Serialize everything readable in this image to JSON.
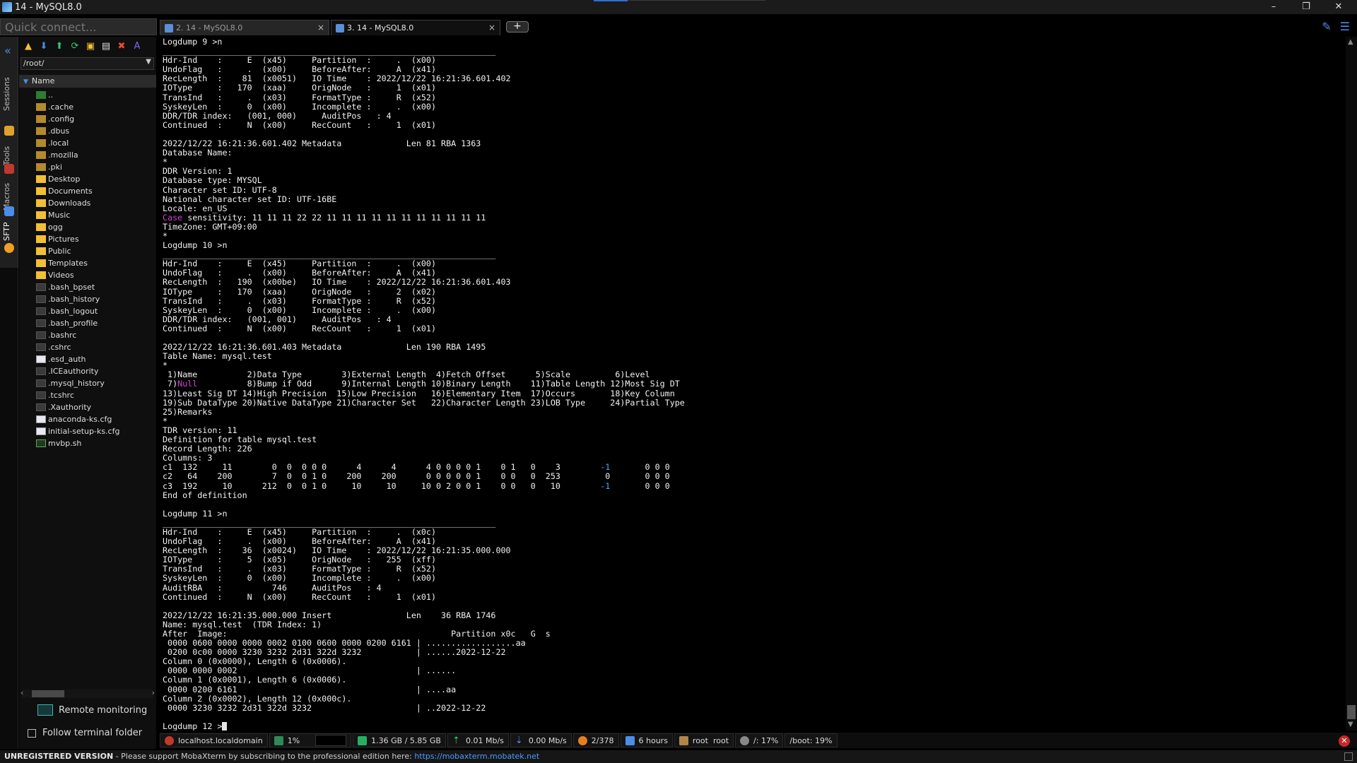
{
  "window": {
    "title": "14 - MySQL8.0",
    "minimize": "–",
    "maximize": "❐",
    "close": "✕"
  },
  "quick_connect": {
    "placeholder": "Quick connect..."
  },
  "tabs": [
    {
      "label": "2. 14 - MySQL8.0",
      "close": "×"
    },
    {
      "label": "3. 14 - MySQL8.0",
      "close": "×"
    }
  ],
  "new_tab": "+",
  "side_tabs": {
    "sessions": "Sessions",
    "tools": "Tools",
    "macros": "Macros",
    "sftp": "SFTP"
  },
  "sftp": {
    "path": "/root/",
    "column": "Name",
    "items": [
      {
        "name": "..",
        "kind": "up"
      },
      {
        "name": ".cache",
        "kind": "folder-hidden"
      },
      {
        "name": ".config",
        "kind": "folder-hidden"
      },
      {
        "name": ".dbus",
        "kind": "folder-hidden"
      },
      {
        "name": ".local",
        "kind": "folder-hidden"
      },
      {
        "name": ".mozilla",
        "kind": "folder-hidden"
      },
      {
        "name": ".pki",
        "kind": "folder-hidden"
      },
      {
        "name": "Desktop",
        "kind": "folder"
      },
      {
        "name": "Documents",
        "kind": "folder"
      },
      {
        "name": "Downloads",
        "kind": "folder"
      },
      {
        "name": "Music",
        "kind": "folder"
      },
      {
        "name": "ogg",
        "kind": "folder"
      },
      {
        "name": "Pictures",
        "kind": "folder"
      },
      {
        "name": "Public",
        "kind": "folder"
      },
      {
        "name": "Templates",
        "kind": "folder"
      },
      {
        "name": "Videos",
        "kind": "folder"
      },
      {
        "name": ".bash_bpset",
        "kind": "file"
      },
      {
        "name": ".bash_history",
        "kind": "file"
      },
      {
        "name": ".bash_logout",
        "kind": "file"
      },
      {
        "name": ".bash_profile",
        "kind": "file"
      },
      {
        "name": ".bashrc",
        "kind": "file"
      },
      {
        "name": ".cshrc",
        "kind": "file"
      },
      {
        "name": ".esd_auth",
        "kind": "cfg"
      },
      {
        "name": ".ICEauthority",
        "kind": "file"
      },
      {
        "name": ".mysql_history",
        "kind": "file"
      },
      {
        "name": ".tcshrc",
        "kind": "file"
      },
      {
        "name": ".Xauthority",
        "kind": "file"
      },
      {
        "name": "anaconda-ks.cfg",
        "kind": "cfg"
      },
      {
        "name": "initial-setup-ks.cfg",
        "kind": "cfg"
      },
      {
        "name": "mvbp.sh",
        "kind": "sh"
      }
    ],
    "remote_monitoring": "Remote monitoring",
    "follow_terminal_folder": "Follow terminal folder"
  },
  "terminal": {
    "lines": [
      "Logdump 9 >n",
      "___________________________________________________________________",
      "Hdr-Ind    :     E  (x45)     Partition  :     .  (x00)",
      "UndoFlag   :     .  (x00)     BeforeAfter:     A  (x41)",
      "RecLength  :    81  (x0051)   IO Time    : 2022/12/22 16:21:36.601.402",
      "IOType     :   170  (xaa)     OrigNode   :     1  (x01)",
      "TransInd   :     .  (x03)     FormatType :     R  (x52)",
      "SyskeyLen  :     0  (x00)     Incomplete :     .  (x00)",
      "DDR/TDR index:   (001, 000)     AuditPos   : 4",
      "Continued  :     N  (x00)     RecCount   :     1  (x01)",
      "",
      "2022/12/22 16:21:36.601.402 Metadata             Len 81 RBA 1363",
      "Database Name:",
      "*",
      "DDR Version: 1",
      "Database type: MYSQL",
      "Character set ID: UTF-8",
      "National character set ID: UTF-16BE",
      "Locale: en_US",
      "Case sensitivity: 11 11 11 22 22 11 11 11 11 11 11 11 11 11 11 11",
      "TimeZone: GMT+09:00",
      "*",
      "Logdump 10 >n",
      "___________________________________________________________________",
      "Hdr-Ind    :     E  (x45)     Partition  :     .  (x00)",
      "UndoFlag   :     .  (x00)     BeforeAfter:     A  (x41)",
      "RecLength  :   190  (x00be)   IO Time    : 2022/12/22 16:21:36.601.403",
      "IOType     :   170  (xaa)     OrigNode   :     2  (x02)",
      "TransInd   :     .  (x03)     FormatType :     R  (x52)",
      "SyskeyLen  :     0  (x00)     Incomplete :     .  (x00)",
      "DDR/TDR index:   (001, 001)     AuditPos   : 4",
      "Continued  :     N  (x00)     RecCount   :     1  (x01)",
      "",
      "2022/12/22 16:21:36.601.403 Metadata             Len 190 RBA 1495",
      "Table Name: mysql.test",
      "*",
      " 1)Name          2)Data Type        3)External Length  4)Fetch Offset      5)Scale         6)Level",
      " 7)Null          8)Bump if Odd      9)Internal Length 10)Binary Length    11)Table Length 12)Most Sig DT",
      "13)Least Sig DT 14)High Precision  15)Low Precision   16)Elementary Item  17)Occurs       18)Key Column",
      "19)Sub DataType 20)Native DataType 21)Character Set   22)Character Length 23)LOB Type     24)Partial Type",
      "25)Remarks",
      "*",
      "TDR version: 11",
      "Definition for table mysql.test",
      "Record Length: 226",
      "Columns: 3",
      "c1  132     11        0  0  0 0 0      4      4      4 0 0 0 0 1    0 1   0    3        -1       0 0 0",
      "c2   64    200        7  0  0 1 0    200    200      0 0 0 0 0 1    0 0   0  253         0       0 0 0",
      "c3  192     10      212  0  0 1 0     10     10     10 0 2 0 0 1    0 0   0   10        -1       0 0 0",
      "End of definition",
      "",
      "Logdump 11 >n",
      "___________________________________________________________________",
      "Hdr-Ind    :     E  (x45)     Partition  :     .  (x0c)",
      "UndoFlag   :     .  (x00)     BeforeAfter:     A  (x41)",
      "RecLength  :    36  (x0024)   IO Time    : 2022/12/22 16:21:35.000.000",
      "IOType     :     5  (x05)     OrigNode   :   255  (xff)",
      "TransInd   :     .  (x03)     FormatType :     R  (x52)",
      "SyskeyLen  :     0  (x00)     Incomplete :     .  (x00)",
      "AuditRBA   :          746     AuditPos   : 4",
      "Continued  :     N  (x00)     RecCount   :     1  (x01)",
      "",
      "2022/12/22 16:21:35.000.000 Insert               Len    36 RBA 1746",
      "Name: mysql.test  (TDR Index: 1)",
      "After  Image:                                             Partition x0c   G  s",
      " 0000 0600 0000 0000 0002 0100 0600 0000 0200 6161 | ..................aa",
      " 0200 0c00 0000 3230 3232 2d31 322d 3232           | ......2022-12-22",
      "Column 0 (0x0000), Length 6 (0x0006).",
      " 0000 0000 0002                                    | ......",
      "Column 1 (0x0001), Length 6 (0x0006).",
      " 0000 0200 6161                                    | ....aa",
      "Column 2 (0x0002), Length 12 (0x000c).",
      " 0000 3230 3232 2d31 322d 3232                     | ..2022-12-22",
      "",
      "Logdump 12 >"
    ]
  },
  "statusbar": {
    "host": "localhost.localdomain",
    "cpu": "1%",
    "memory": "1.36 GB / 5.85 GB",
    "upload": "0.01 Mb/s",
    "download": "0.00 Mb/s",
    "connections": "2/378",
    "uptime": "6 hours",
    "user": "root  root",
    "disk_root": "/: 17%",
    "disk_boot": "/boot: 19%"
  },
  "footer": {
    "unregistered": "UNREGISTERED VERSION",
    "message": " -  Please support MobaXterm by subscribing to the professional edition here: ",
    "link": "https://mobaxterm.mobatek.net"
  },
  "colors": {
    "accent": "#4a8ee8",
    "magenta": "#d642d6",
    "cyan": "#3ab0ff",
    "folder": "#f2c033"
  }
}
